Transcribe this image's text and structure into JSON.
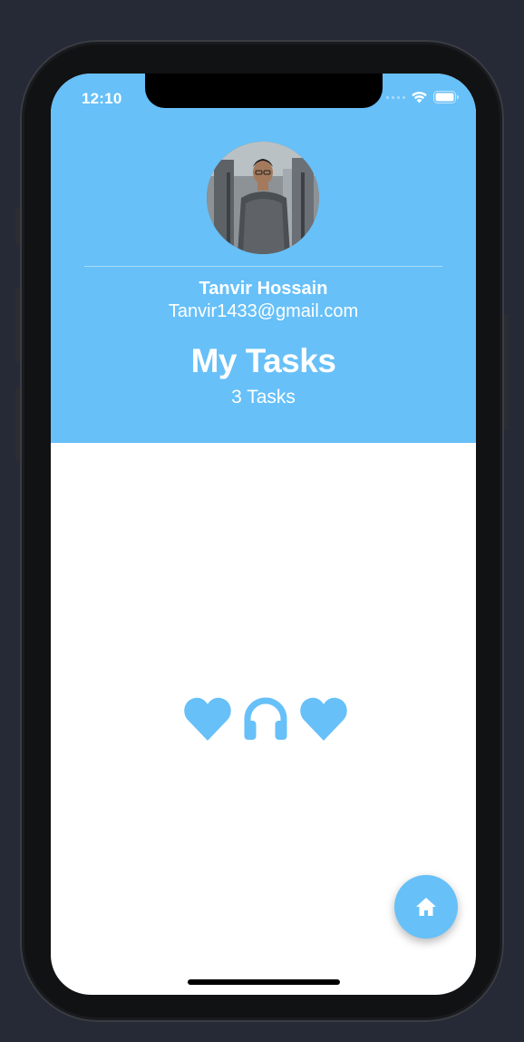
{
  "status_bar": {
    "time": "12:10",
    "wifi_icon": "wifi-icon",
    "battery_icon": "battery-icon"
  },
  "profile": {
    "name": "Tanvir Hossain",
    "email": "Tanvir1433@gmail.com",
    "avatar_icon": "profile-photo"
  },
  "tasks": {
    "title": "My Tasks",
    "count_label": "3 Tasks"
  },
  "center_icons": [
    "heart-icon",
    "headphones-icon",
    "heart-icon"
  ],
  "fab": {
    "icon": "home-icon"
  },
  "colors": {
    "accent": "#67c0f8",
    "background": "#ffffff",
    "text_on_accent": "#ffffff"
  }
}
